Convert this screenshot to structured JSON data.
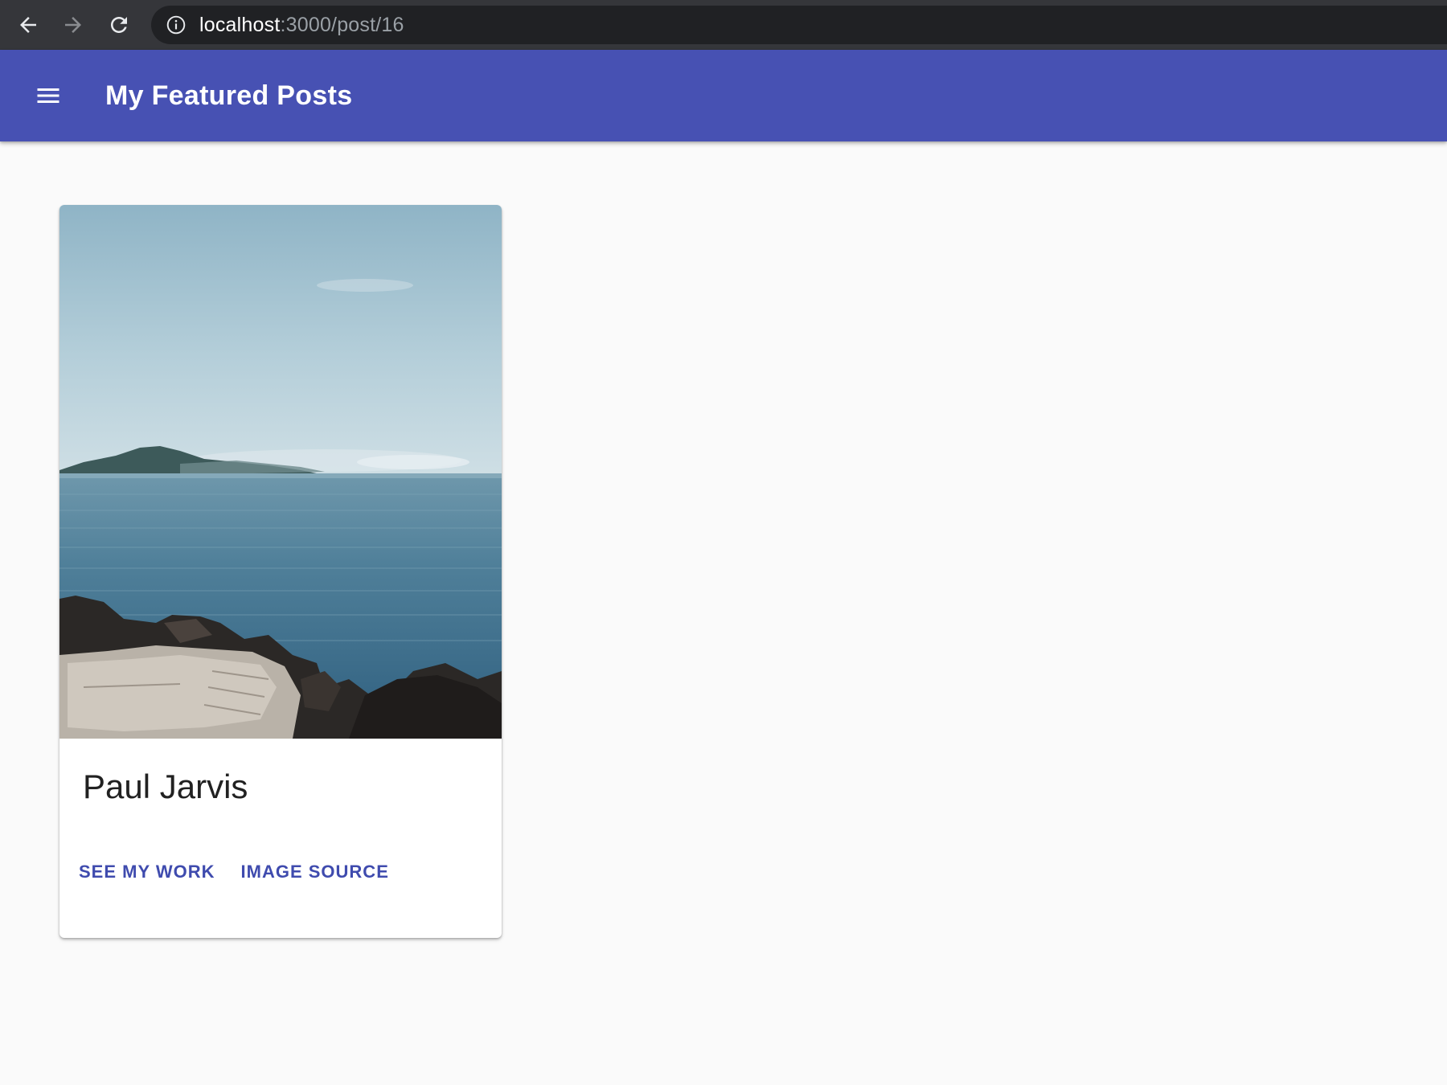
{
  "browser": {
    "url_host": "localhost",
    "url_path": ":3000/post/16",
    "back_icon": "arrow-left-icon",
    "forward_icon": "arrow-right-icon",
    "reload_icon": "reload-icon",
    "info_icon": "info-icon"
  },
  "app_bar": {
    "title": "My Featured Posts",
    "menu_icon": "hamburger-menu-icon",
    "color": "#4751b3"
  },
  "post": {
    "author": "Paul Jarvis",
    "image_alt": "Sea with rocky shore and distant island",
    "actions": [
      {
        "label": "SEE MY WORK"
      },
      {
        "label": "IMAGE SOURCE"
      }
    ],
    "action_color": "#3f4bae"
  }
}
